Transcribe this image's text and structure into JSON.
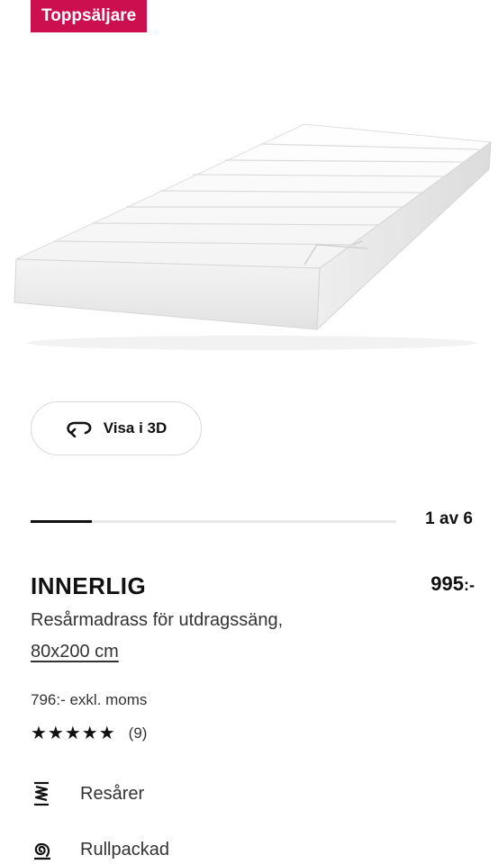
{
  "badge": {
    "label": "Toppsäljare",
    "color": "#cc0f4e"
  },
  "media": {
    "image_alt": "mattress-product-image",
    "view3d_label": "Visa i 3D",
    "view3d_icon": "rotate-3d-icon",
    "carousel_progress": 0.167,
    "pager_text": "1 av 6"
  },
  "product": {
    "name": "INNERLIG",
    "price_value": "995",
    "price_suffix": ":-",
    "description": "Resårmadrass för utdragssäng,",
    "size": "80x200 cm",
    "price_ex_vat": "796:- exkl. moms",
    "rating": {
      "stars": "★★★★★",
      "value": 5,
      "max": 5,
      "count_text": "(9)"
    }
  },
  "features": [
    {
      "icon": "spring-icon",
      "label": "Resårer"
    },
    {
      "icon": "rolled-icon",
      "label": "Rullpackad"
    }
  ]
}
